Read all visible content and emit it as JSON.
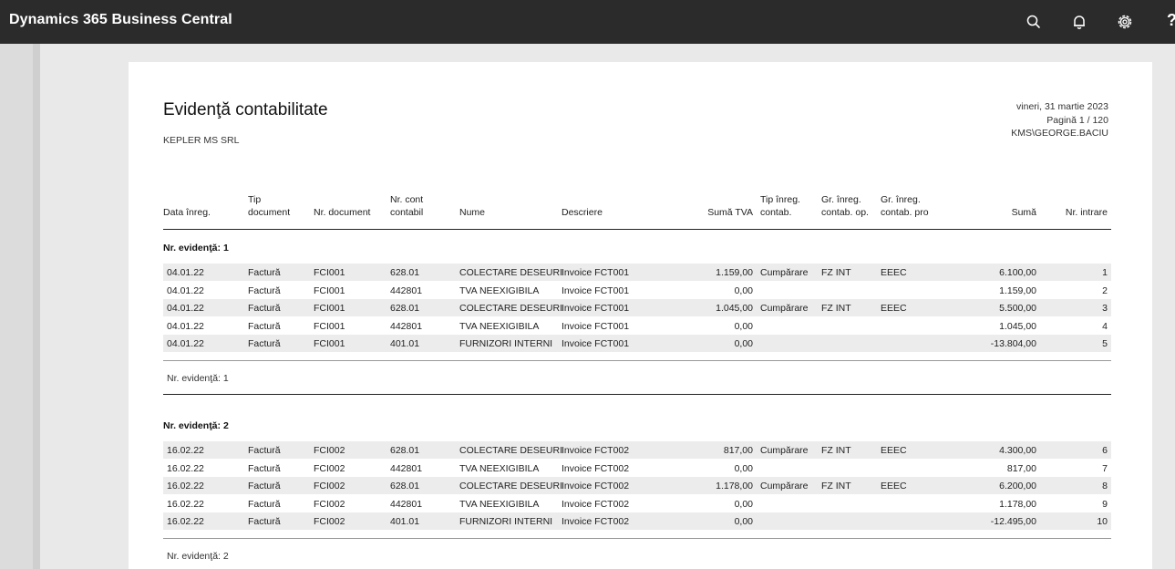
{
  "app": {
    "title": "Dynamics 365 Business Central",
    "help_symbol": "?"
  },
  "report": {
    "title": "Evidenţă contabilitate",
    "company": "KEPLER MS SRL",
    "date": "vineri, 31 martie 2023",
    "page": "Pagină 1 / 120",
    "user": "KMS\\GEORGE.BACIU"
  },
  "columns": {
    "posting_date": "Data înreg.",
    "doc_type_1": "Tip",
    "doc_type_2": "document",
    "doc_no": "Nr. document",
    "account_1": "Nr. cont",
    "account_2": "contabil",
    "name": "Nume",
    "description": "Descriere",
    "vat_amount": "Sumă TVA",
    "posting_type_1": "Tip înreg.",
    "posting_type_2": "contab.",
    "bus_group_1": "Gr. înreg.",
    "bus_group_2": "contab. op.",
    "prod_group_1": "Gr. înreg.",
    "prod_group_2": "contab. pro",
    "amount": "Sumă",
    "entry_no": "Nr. intrare"
  },
  "groups": [
    {
      "header": "Nr. evidenţă: 1",
      "footer": "Nr. evidenţă: 1",
      "rows": [
        {
          "date": "04.01.22",
          "type": "Factură",
          "doc": "FCI001",
          "acct": "628.01",
          "name": "COLECTARE DESEURI",
          "desc": "Invoice FCT001",
          "vat": "1.159,00",
          "ptype": "Cumpărare",
          "bus": "FZ INT",
          "prod": "EEEC",
          "amount": "6.100,00",
          "entry": "1"
        },
        {
          "date": "04.01.22",
          "type": "Factură",
          "doc": "FCI001",
          "acct": "442801",
          "name": "TVA NEEXIGIBILA",
          "desc": "Invoice FCT001",
          "vat": "0,00",
          "ptype": "",
          "bus": "",
          "prod": "",
          "amount": "1.159,00",
          "entry": "2"
        },
        {
          "date": "04.01.22",
          "type": "Factură",
          "doc": "FCI001",
          "acct": "628.01",
          "name": "COLECTARE DESEURI",
          "desc": "Invoice FCT001",
          "vat": "1.045,00",
          "ptype": "Cumpărare",
          "bus": "FZ INT",
          "prod": "EEEC",
          "amount": "5.500,00",
          "entry": "3"
        },
        {
          "date": "04.01.22",
          "type": "Factură",
          "doc": "FCI001",
          "acct": "442801",
          "name": "TVA NEEXIGIBILA",
          "desc": "Invoice FCT001",
          "vat": "0,00",
          "ptype": "",
          "bus": "",
          "prod": "",
          "amount": "1.045,00",
          "entry": "4"
        },
        {
          "date": "04.01.22",
          "type": "Factură",
          "doc": "FCI001",
          "acct": "401.01",
          "name": "FURNIZORI INTERNI",
          "desc": "Invoice FCT001",
          "vat": "0,00",
          "ptype": "",
          "bus": "",
          "prod": "",
          "amount": "-13.804,00",
          "entry": "5"
        }
      ]
    },
    {
      "header": "Nr. evidenţă: 2",
      "footer": "Nr. evidenţă: 2",
      "rows": [
        {
          "date": "16.02.22",
          "type": "Factură",
          "doc": "FCI002",
          "acct": "628.01",
          "name": "COLECTARE DESEURI",
          "desc": "Invoice FCT002",
          "vat": "817,00",
          "ptype": "Cumpărare",
          "bus": "FZ INT",
          "prod": "EEEC",
          "amount": "4.300,00",
          "entry": "6"
        },
        {
          "date": "16.02.22",
          "type": "Factură",
          "doc": "FCI002",
          "acct": "442801",
          "name": "TVA NEEXIGIBILA",
          "desc": "Invoice FCT002",
          "vat": "0,00",
          "ptype": "",
          "bus": "",
          "prod": "",
          "amount": "817,00",
          "entry": "7"
        },
        {
          "date": "16.02.22",
          "type": "Factură",
          "doc": "FCI002",
          "acct": "628.01",
          "name": "COLECTARE DESEURI",
          "desc": "Invoice FCT002",
          "vat": "1.178,00",
          "ptype": "Cumpărare",
          "bus": "FZ INT",
          "prod": "EEEC",
          "amount": "6.200,00",
          "entry": "8"
        },
        {
          "date": "16.02.22",
          "type": "Factură",
          "doc": "FCI002",
          "acct": "442801",
          "name": "TVA NEEXIGIBILA",
          "desc": "Invoice FCT002",
          "vat": "0,00",
          "ptype": "",
          "bus": "",
          "prod": "",
          "amount": "1.178,00",
          "entry": "9"
        },
        {
          "date": "16.02.22",
          "type": "Factură",
          "doc": "FCI002",
          "acct": "401.01",
          "name": "FURNIZORI INTERNI",
          "desc": "Invoice FCT002",
          "vat": "0,00",
          "ptype": "",
          "bus": "",
          "prod": "",
          "amount": "-12.495,00",
          "entry": "10"
        }
      ]
    }
  ]
}
